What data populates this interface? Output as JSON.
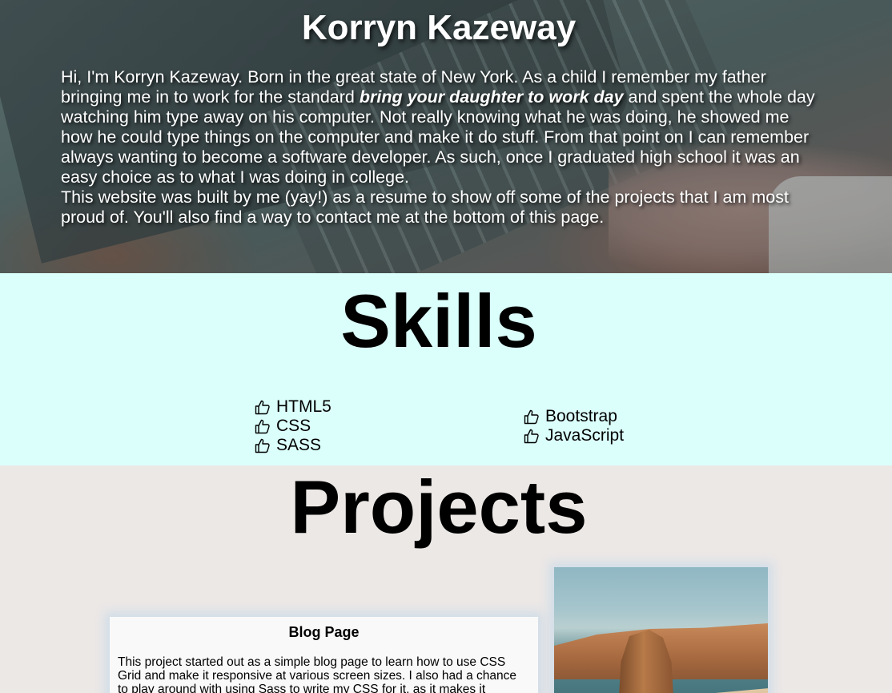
{
  "hero": {
    "title": "Korryn Kazeway",
    "intro_before": "Hi, I'm Korryn Kazeway. Born in the great state of New York. As a child I remember my father bringing me in to work for the standard ",
    "intro_emphasis": "bring your daughter to work day",
    "intro_after": " and spent the whole day watching him type away on his computer. Not really knowing what he was doing, he showed me how he could type things on the computer and make it do stuff. From that point on I can remember always wanting to become a software developer. As such, once I graduated high school it was an easy choice as to what I was doing in college.",
    "intro_second": "This website was built by me (yay!) as a resume to show off some of the projects that I am most proud of. You'll also find a way to contact me at the bottom of this page."
  },
  "skills": {
    "title": "Skills",
    "column1": [
      "HTML5",
      "CSS",
      "SASS"
    ],
    "column2": [
      "Bootstrap",
      "JavaScript"
    ],
    "icon": "thumbs-up-icon"
  },
  "projects": {
    "title": "Projects",
    "card": {
      "title": "Blog Page",
      "text": "This project started out as a simple blog page to learn how to use CSS Grid and make it responsive at various screen sizes. I also had a chance to play around with using Sass to write my CSS for it, as it makes it"
    },
    "image_icon": "coastal-cliffs-photo"
  },
  "colors": {
    "skills_bg": "#dbfffb",
    "projects_bg": "#ece8e6",
    "card_bg": "#f9f9f9"
  }
}
